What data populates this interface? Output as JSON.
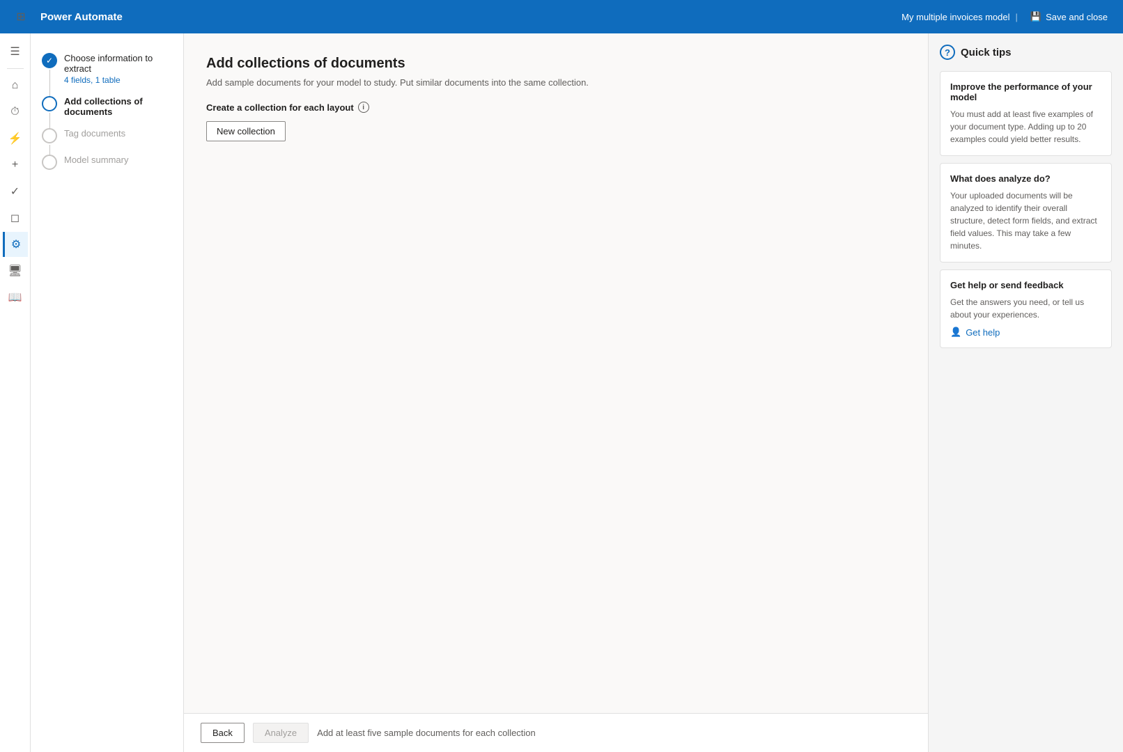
{
  "topbar": {
    "app_name": "Power Automate",
    "model_name": "My multiple invoices model",
    "save_close_label": "Save and close"
  },
  "steps": [
    {
      "id": "choose-info",
      "title": "Choose information to extract",
      "subtitle": "4 fields, 1 table",
      "state": "completed"
    },
    {
      "id": "add-collections",
      "title": "Add collections of documents",
      "subtitle": "",
      "state": "active"
    },
    {
      "id": "tag-documents",
      "title": "Tag documents",
      "subtitle": "",
      "state": "inactive"
    },
    {
      "id": "model-summary",
      "title": "Model summary",
      "subtitle": "",
      "state": "inactive"
    }
  ],
  "main": {
    "page_title": "Add collections of documents",
    "page_subtitle": "Add sample documents for your model to study. Put similar documents into the same collection.",
    "section_label": "Create a collection for each layout",
    "new_collection_label": "New collection"
  },
  "footer": {
    "back_label": "Back",
    "analyze_label": "Analyze",
    "hint_text": "Add at least five sample documents for each collection"
  },
  "quick_tips": {
    "header": "Quick tips",
    "cards": [
      {
        "title": "Improve the performance of your model",
        "text": "You must add at least five examples of your document type. Adding up to 20 examples could yield better results."
      },
      {
        "title": "What does analyze do?",
        "text": "Your uploaded documents will be analyzed to identify their overall structure, detect form fields, and extract field values. This may take a few minutes."
      },
      {
        "title": "Get help or send feedback",
        "text": "Get the answers you need, or tell us about your experiences.",
        "link_label": "Get help"
      }
    ]
  },
  "icons": {
    "grid": "⊞",
    "home": "⌂",
    "clock": "⏱",
    "flow": "⚡",
    "plus": "+",
    "approval": "✓",
    "monitor": "◻",
    "robot": "⚙",
    "desktop": "🖥",
    "book": "📖",
    "save": "💾",
    "question": "?",
    "help_person": "👤"
  }
}
